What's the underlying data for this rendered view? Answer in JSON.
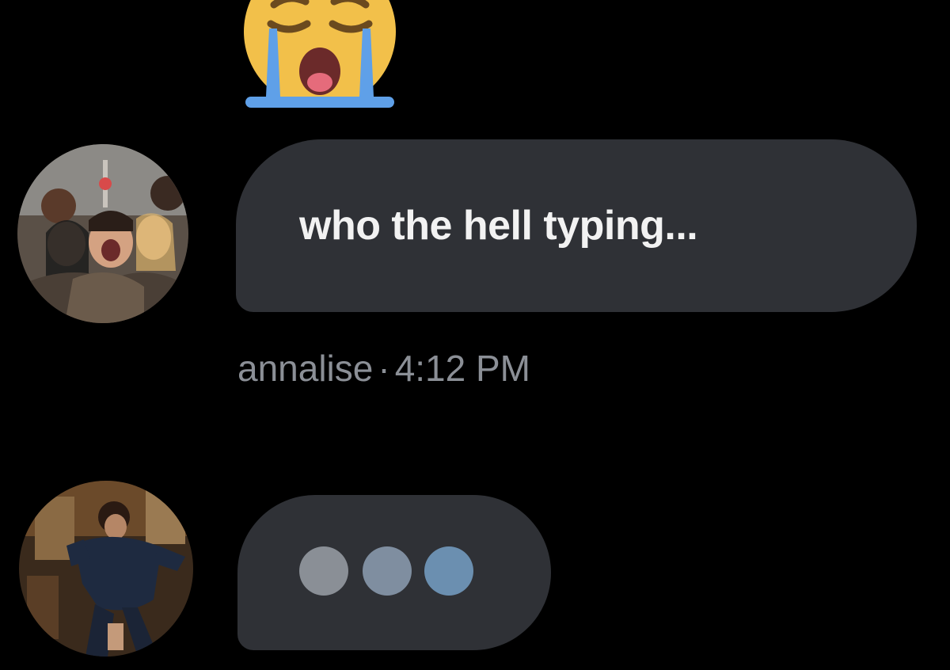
{
  "reaction": {
    "emoji_icon": "loudly-crying-face-icon"
  },
  "messages": [
    {
      "avatar_icon": "group-selfie-avatar",
      "text": "who the hell typing...",
      "sender": "annalise",
      "separator": "·",
      "time": "4:12 PM"
    }
  ],
  "typing": {
    "avatar_icon": "dancing-person-avatar",
    "indicator_icon": "typing-dots-icon"
  },
  "colors": {
    "background": "#000000",
    "bubble": "#2f3136",
    "message_text": "#f2f2f2",
    "meta_text": "#8b8f96",
    "dot_1": "#8a8f96",
    "dot_2": "#7f8ea0",
    "dot_3": "#6b8fb0"
  }
}
